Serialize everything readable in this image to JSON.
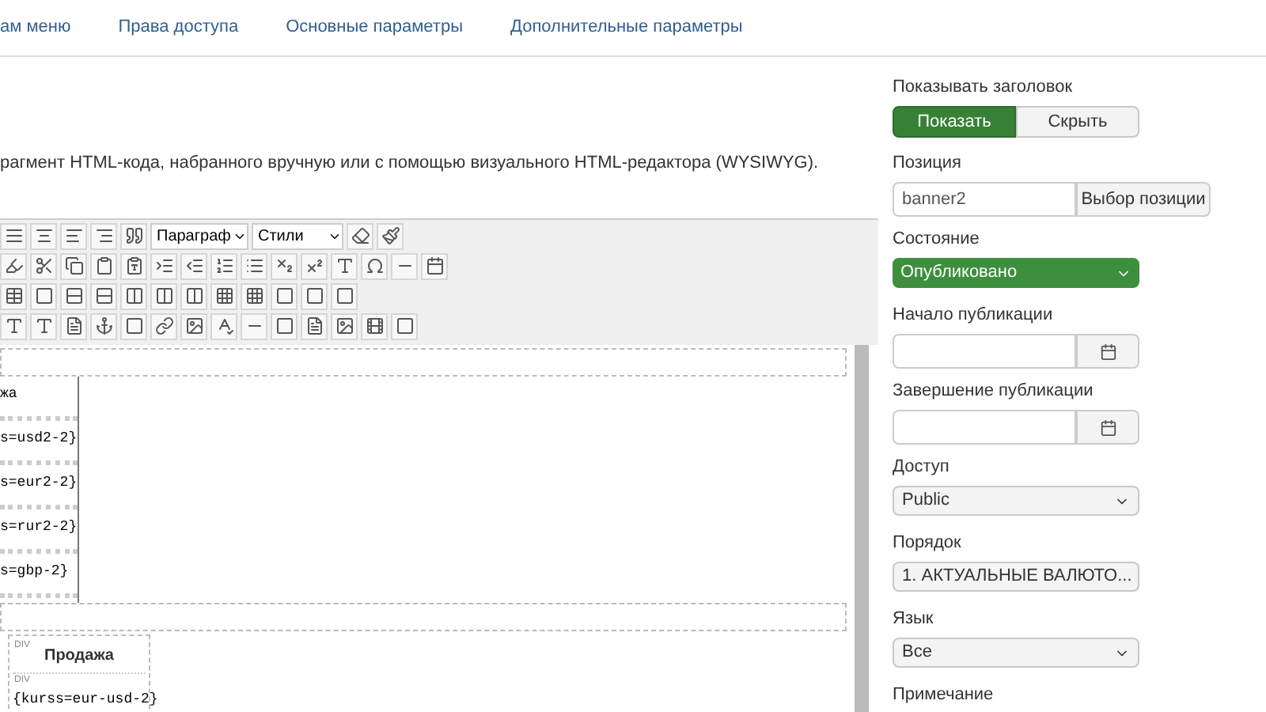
{
  "tabs": [
    {
      "label": "ам меню",
      "selected": false
    },
    {
      "label": "Права доступа",
      "selected": false
    },
    {
      "label": "Основные параметры",
      "selected": false
    },
    {
      "label": "Дополнительные параметры",
      "selected": false
    }
  ],
  "description": "рагмент HTML-кода, набранного вручную или с помощью визуального HTML-редактора (WYSIWYG).",
  "editor": {
    "format_select": "Параграф",
    "style_select": "Стили",
    "table_cells": [
      "жа",
      "s=usd2-2}",
      "s=eur2-2}",
      "s=rur2-2}",
      "s=gbp-2}"
    ],
    "block": {
      "tag_1": "DIV",
      "heading": "Продажа",
      "tag_2": "DIV",
      "code": "{kurss=eur-usd-2}"
    }
  },
  "sidebar": [
    {
      "kind": "toggle",
      "label": "Показывать заголовок",
      "options": [
        {
          "label": "Показать",
          "selected": true
        },
        {
          "label": "Скрыть",
          "selected": false
        }
      ]
    },
    {
      "kind": "input_button",
      "label": "Позиция",
      "value": "banner2",
      "button": "Выбор позиции"
    },
    {
      "kind": "status_select",
      "label": "Состояние",
      "value": "Опубликовано"
    },
    {
      "kind": "date",
      "label": "Начало публикации"
    },
    {
      "kind": "date",
      "label": "Завершение публикации"
    },
    {
      "kind": "select",
      "label": "Доступ",
      "value": "Public"
    },
    {
      "kind": "select",
      "label": "Порядок",
      "value": "1. АКТУАЛЬНЫЕ ВАЛЮТО..."
    },
    {
      "kind": "select",
      "label": "Язык",
      "value": "Все"
    },
    {
      "kind": "label",
      "label": "Примечание"
    }
  ]
}
